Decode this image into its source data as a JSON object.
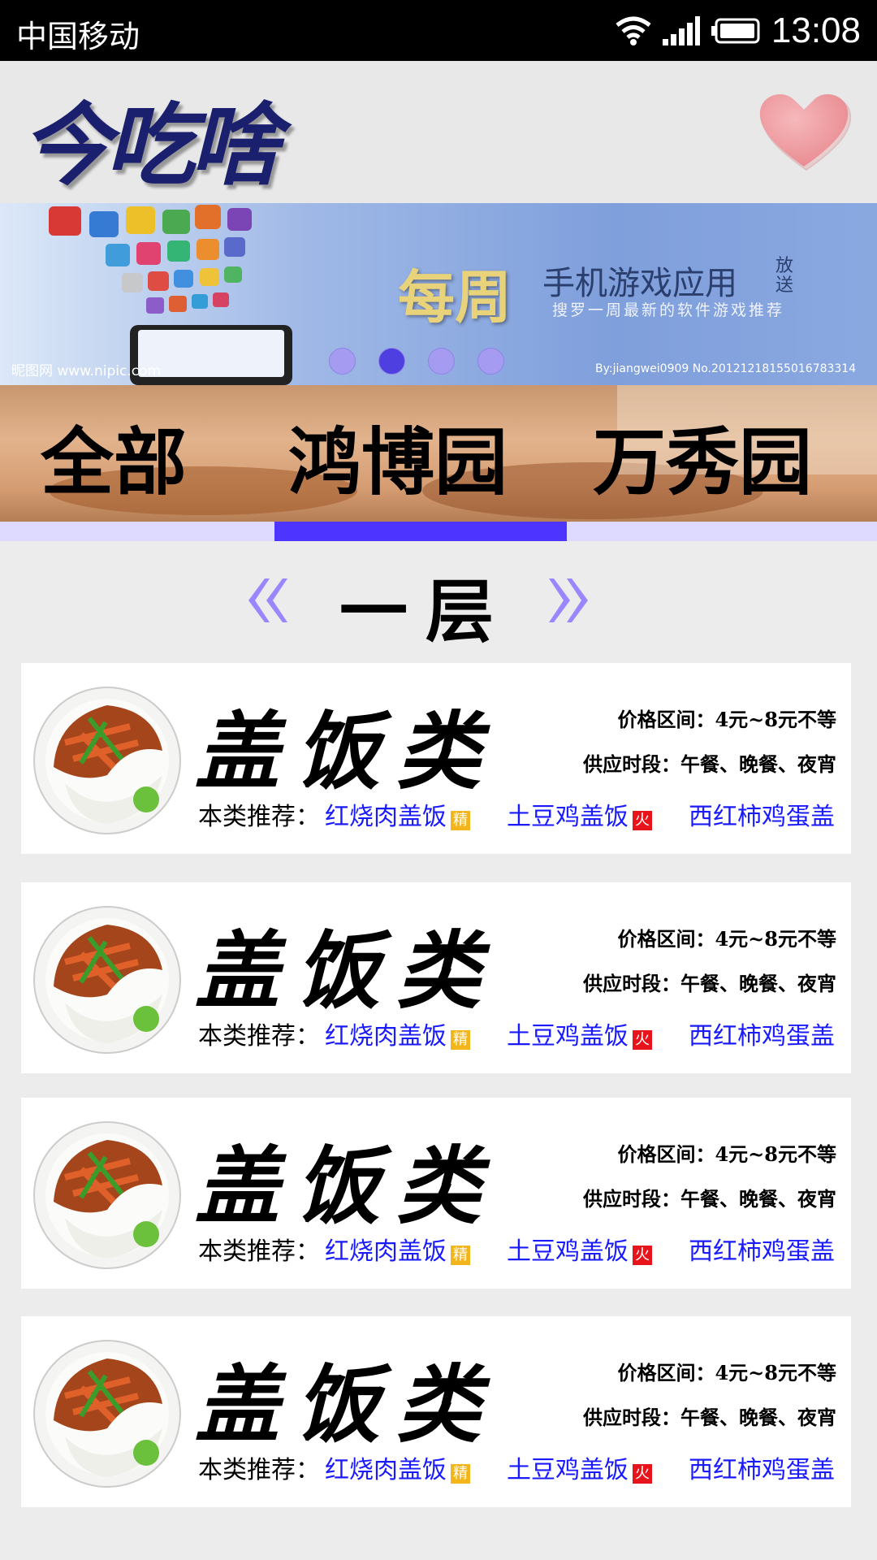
{
  "status_bar": {
    "carrier": "中国移动",
    "time": "13:08",
    "icons": [
      "wifi-icon",
      "signal-icon",
      "battery-icon"
    ]
  },
  "header": {
    "logo_text": "今吃啥",
    "favorite_icon": "heart-icon"
  },
  "banner": {
    "headline_big": "每周",
    "headline_small": "手机游戏应用",
    "headline_vertical": "放送",
    "subtitle": "搜罗一周最新的软件游戏推荐",
    "watermark_left": "昵图网 www.nipic.com",
    "watermark_right": "By:jiangwei0909  No.20121218155016783314",
    "slide_count": 4,
    "active_slide": 2
  },
  "category_tabs": {
    "items": [
      "全部",
      "鸿博园",
      "万秀园"
    ],
    "selected_index": 1
  },
  "floor": {
    "title": "一层",
    "prev_icon": "double-chevron-left-icon",
    "next_icon": "double-chevron-right-icon"
  },
  "cards": [
    {
      "title": "盖饭类",
      "price_range": "价格区间：4元~8元不等",
      "hours": "供应时段：午餐、晚餐、夜宵",
      "recommend_label": "本类推荐：",
      "dishes": [
        "红烧肉盖饭",
        "土豆鸡盖饭",
        "西红柿鸡蛋盖"
      ],
      "badges": [
        "精",
        "火"
      ]
    },
    {
      "title": "盖饭类",
      "price_range": "价格区间：4元~8元不等",
      "hours": "供应时段：午餐、晚餐、夜宵",
      "recommend_label": "本类推荐：",
      "dishes": [
        "红烧肉盖饭",
        "土豆鸡盖饭",
        "西红柿鸡蛋盖"
      ],
      "badges": [
        "精",
        "火"
      ]
    },
    {
      "title": "盖饭类",
      "price_range": "价格区间：4元~8元不等",
      "hours": "供应时段：午餐、晚餐、夜宵",
      "recommend_label": "本类推荐：",
      "dishes": [
        "红烧肉盖饭",
        "土豆鸡盖饭",
        "西红柿鸡蛋盖"
      ],
      "badges": [
        "精",
        "火"
      ]
    },
    {
      "title": "盖饭类",
      "price_range": "价格区间：4元~8元不等",
      "hours": "供应时段：午餐、晚餐、夜宵",
      "recommend_label": "本类推荐：",
      "dishes": [
        "红烧肉盖饭",
        "土豆鸡盖饭",
        "西红柿鸡蛋盖"
      ],
      "badges": [
        "精",
        "火"
      ]
    }
  ],
  "colors": {
    "tab_indicator": "#4d35ff",
    "dish_link": "#1a1aff",
    "badge_fine": "#f2b51c",
    "badge_hot": "#e8141b",
    "logo": "#1a1f6e"
  }
}
